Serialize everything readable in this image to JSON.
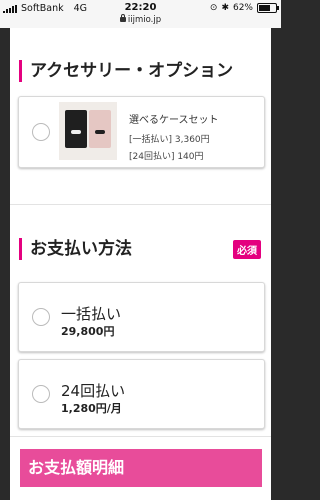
{
  "status_bar": {
    "carrier": "SoftBank",
    "network": "4G",
    "time": "22:20",
    "url": "iijmio.jp",
    "battery": "62%"
  },
  "accessory": {
    "title": "アクセサリー・オプション",
    "item_name": "選べるケースセット",
    "price_lump": "[一括払い] 3,360円",
    "price_installment": "[24回払い] 140円"
  },
  "payment": {
    "title": "お支払い方法",
    "required": "必須",
    "options": [
      {
        "label": "一括払い",
        "price": "29,800円"
      },
      {
        "label": "24回払い",
        "price": "1,280円/月"
      }
    ]
  },
  "summary": {
    "title": "お支払額明細"
  },
  "colors": {
    "accent": "#e4007f",
    "summary_bar": "#e84c9a"
  }
}
